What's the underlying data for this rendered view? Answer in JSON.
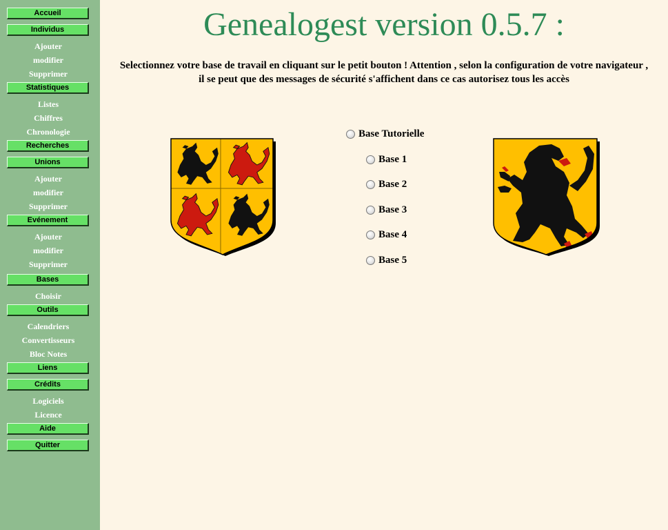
{
  "app": {
    "title": "Genealogest version 0.5.7 :",
    "notice": "Selectionnez votre base de travail en cliquant sur le petit bouton ! Attention , selon la configuration de votre navigateur , il se peut que des messages de sécurité s'affichent dans ce cas autorisez tous les accès"
  },
  "sidebar": {
    "accueil": "Accueil",
    "individus": "Individus",
    "ind_ajouter": "Ajouter",
    "ind_modifier": "modifier",
    "ind_supprimer": "Supprimer",
    "statistiques": "Statistiques",
    "stat_listes": "Listes",
    "stat_chiffres": "Chiffres",
    "stat_chronologie": "Chronologie",
    "recherches": "Recherches",
    "unions": "Unions",
    "uni_ajouter": "Ajouter",
    "uni_modifier": "modifier",
    "uni_supprimer": "Supprimer",
    "evenement": "Evénement",
    "evt_ajouter": "Ajouter",
    "evt_modifier": "modifier",
    "evt_supprimer": "Supprimer",
    "bases": "Bases",
    "bases_choisir": "Choisir",
    "outils": "Outils",
    "out_calendriers": "Calendriers",
    "out_convertisseurs": "Convertisseurs",
    "out_bloc_notes": "Bloc Notes",
    "liens": "Liens",
    "credits": "Crédits",
    "cred_logiciels": "Logiciels",
    "cred_licence": "Licence",
    "aide": "Aide",
    "quitter": "Quitter"
  },
  "bases": {
    "tutorielle": "Base Tutorielle",
    "b1": "Base 1",
    "b2": "Base 2",
    "b3": "Base 3",
    "b4": "Base 4",
    "b5": "Base 5"
  },
  "colors": {
    "sidebar_bg": "#8fbc8f",
    "button_green": "#66e066",
    "title_green": "#2e8b57",
    "page_bg": "#fdf5e6",
    "shield_gold": "#ffbf00",
    "lion_red": "#cc1a0f"
  }
}
